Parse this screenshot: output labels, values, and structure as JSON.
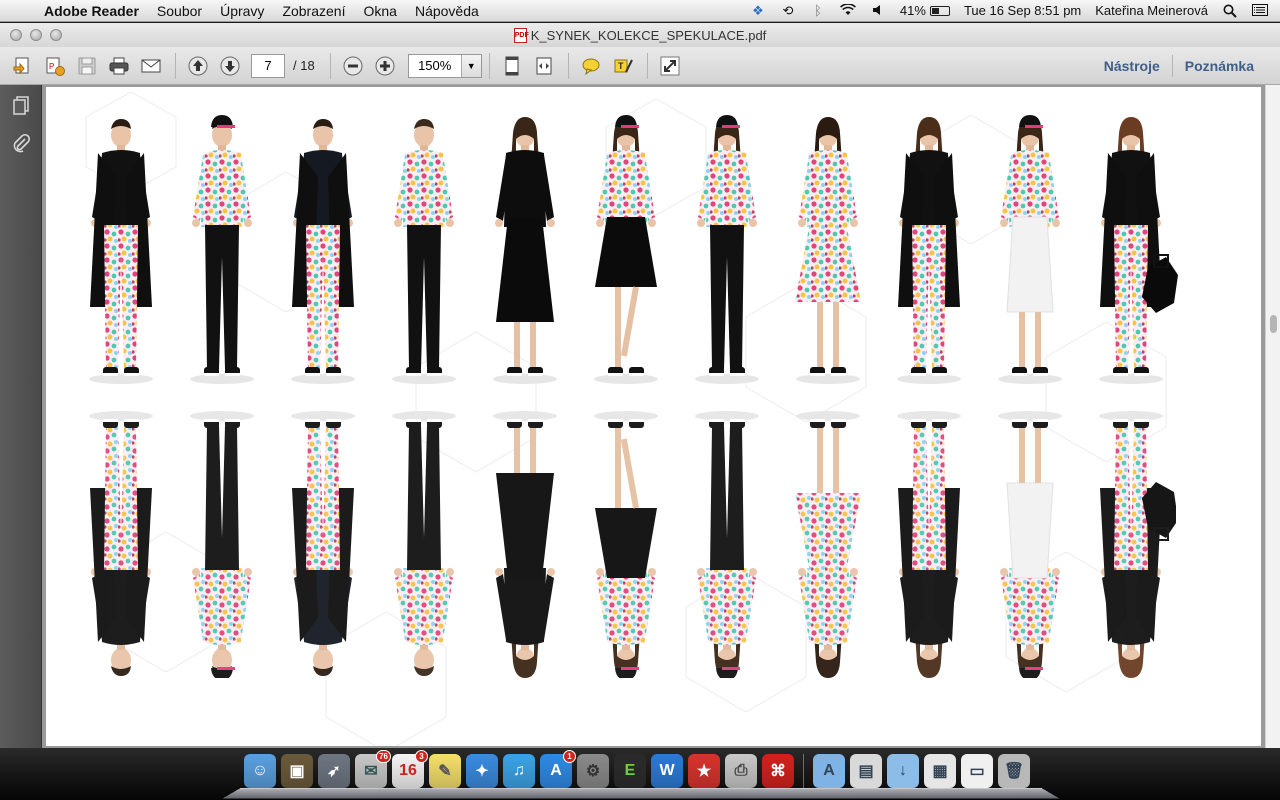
{
  "menubar": {
    "app_name": "Adobe Reader",
    "menus": [
      "Soubor",
      "Úpravy",
      "Zobrazení",
      "Okna",
      "Nápověda"
    ],
    "battery": "41%",
    "datetime": "Tue 16 Sep  8:51 pm",
    "user": "Kateřina Meinerová"
  },
  "window": {
    "title": "K_SYNEK_KOLEKCE_SPEKULACE.pdf"
  },
  "toolbar": {
    "page_current": "7",
    "page_total": "/ 18",
    "zoom": "150%",
    "tools_label": "Nástroje",
    "comment_label": "Poznámka"
  },
  "dock": {
    "items": [
      {
        "name": "finder",
        "glyph": "☺"
      },
      {
        "name": "preview-photos",
        "glyph": "▣"
      },
      {
        "name": "launchpad",
        "glyph": "➶"
      },
      {
        "name": "mail",
        "glyph": "✉",
        "badge": "76"
      },
      {
        "name": "calendar",
        "glyph": "16",
        "badge": "3"
      },
      {
        "name": "stickies",
        "glyph": "✎"
      },
      {
        "name": "safari",
        "glyph": "✦"
      },
      {
        "name": "itunes",
        "glyph": "♫"
      },
      {
        "name": "app-store",
        "glyph": "A",
        "badge": "1"
      },
      {
        "name": "system-preferences",
        "glyph": "⚙"
      },
      {
        "name": "evernote",
        "glyph": "E"
      },
      {
        "name": "word",
        "glyph": "W"
      },
      {
        "name": "wunderlist",
        "glyph": "★"
      },
      {
        "name": "image-capture",
        "glyph": "⎙"
      },
      {
        "name": "adobe-reader",
        "glyph": "⌘"
      }
    ],
    "stack_items": [
      {
        "name": "applications-folder",
        "glyph": "A"
      },
      {
        "name": "document-stack",
        "glyph": "▤"
      },
      {
        "name": "downloads-folder",
        "glyph": "↓"
      },
      {
        "name": "file-stack-1",
        "glyph": "▦"
      },
      {
        "name": "file-stack-2",
        "glyph": "▭"
      },
      {
        "name": "trash",
        "glyph": "🗑"
      }
    ]
  }
}
